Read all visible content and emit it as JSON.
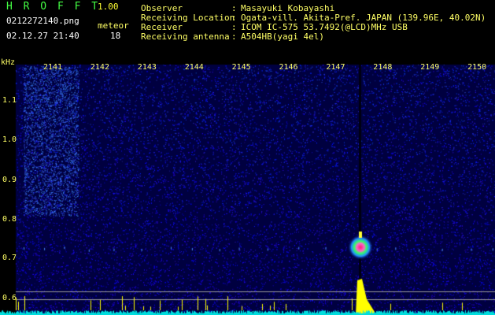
{
  "header": {
    "title": "H R O F F T",
    "version": "1.00",
    "filename": "0212272140.png",
    "datetime": "02.12.27 21:40",
    "meteor_label": "meteor",
    "meteor_count": "18",
    "info": [
      {
        "label": "Observer",
        "value": "Masayuki Kobayashi"
      },
      {
        "label": "Receiving Location",
        "value": "Ogata-vill. Akita-Pref. JAPAN (139.96E, 40.02N)"
      },
      {
        "label": "Receiver",
        "value": "ICOM IC-575 53.7492(@LCD)MHz USB"
      },
      {
        "label": "Receiving antenna",
        "value": "A504HB(yagi 4el)"
      }
    ]
  },
  "axis": {
    "unit": "kHz",
    "y_ticks": [
      "1.1",
      "1.0",
      "0.9",
      "0.8",
      "0.7",
      "0.6"
    ],
    "time_labels": [
      "2141",
      "2142",
      "2143",
      "2144",
      "2145",
      "2146",
      "2147",
      "2148",
      "2149",
      "2150"
    ]
  },
  "colors": {
    "background": "#000000",
    "noise_floor": "#000040",
    "noise_dots": "#2a2ad0",
    "meteor_core": "#ff2a80",
    "baseline_bar": "#ffff00",
    "baseline_noise": "#00dddd"
  }
}
